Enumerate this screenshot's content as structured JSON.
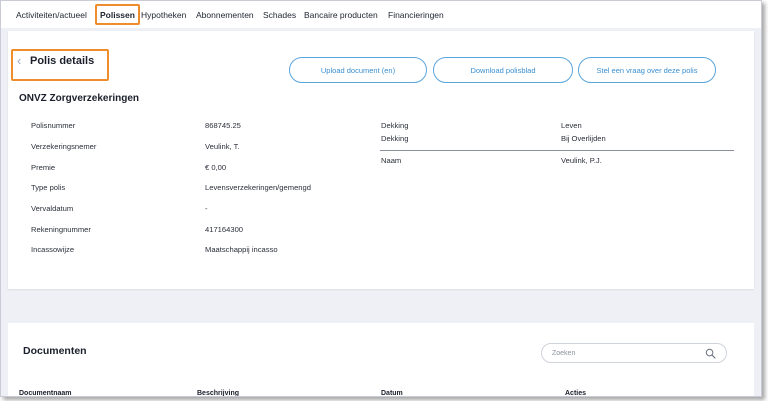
{
  "nav": {
    "items": [
      {
        "label": "Activiteiten/actueel"
      },
      {
        "label": "Polissen"
      },
      {
        "label": "Hypotheken"
      },
      {
        "label": "Abonnementen"
      },
      {
        "label": "Schades"
      },
      {
        "label": "Bancaire producten"
      },
      {
        "label": "Financieringen"
      }
    ],
    "active": "Polissen"
  },
  "policy": {
    "title": "Polis details",
    "back_icon": "chevron-left-icon",
    "buttons": {
      "upload": "Upload document (en)",
      "download": "Download polisblad",
      "question": "Stel een vraag over deze polis"
    },
    "company": "ONVZ Zorgverzekeringen",
    "fields": [
      {
        "label": "Polisnummer",
        "value": "868745.25"
      },
      {
        "label": "Verzekeringsnemer",
        "value": "Veulink, T."
      },
      {
        "label": "Premie",
        "value": "€ 0,00"
      },
      {
        "label": "Type polis",
        "value": "Levensverzekeringen/gemengd"
      },
      {
        "label": "Vervaldatum",
        "value": "-"
      },
      {
        "label": "Rekeningnummer",
        "value": "417164300"
      },
      {
        "label": "Incassowijze",
        "value": "Maatschappij incasso"
      }
    ],
    "coverage": [
      {
        "label": "Dekking",
        "value": "Leven"
      },
      {
        "label": "Dekking",
        "value": "Bij Overlijden"
      }
    ],
    "insured": {
      "label": "Naam",
      "value": "Veulink, P.J."
    }
  },
  "documents": {
    "title": "Documenten",
    "search_placeholder": "Zoeken",
    "search_icon": "search-icon",
    "columns": [
      "Documentnaam",
      "Beschrijving",
      "Datum",
      "Acties"
    ]
  },
  "colors": {
    "highlight": "#ef8c2c",
    "accent": "#3a8fd0",
    "page_bg": "#eef0f6"
  }
}
